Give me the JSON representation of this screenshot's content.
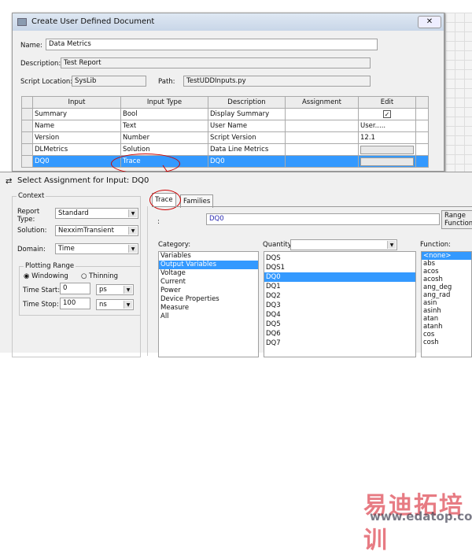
{
  "top_dialog": {
    "title": "Create User Defined Document",
    "name_label": "Name:",
    "name_value": "Data Metrics",
    "description_label": "Description:",
    "description_value": "Test Report",
    "script_location_label": "Script Location:",
    "script_location_value": "SysLib",
    "path_label": "Path:",
    "path_value": "TestUDDInputs.py",
    "columns": [
      "Input",
      "Input Type",
      "Description",
      "Assignment",
      "Edit"
    ],
    "rows": [
      {
        "input": "Summary",
        "type": "Bool",
        "description": "Display Summary",
        "assignment": "",
        "edit": "checkbox-checked"
      },
      {
        "input": "Name",
        "type": "Text",
        "description": "User Name",
        "assignment": "",
        "edit": "User....."
      },
      {
        "input": "Version",
        "type": "Number",
        "description": "Script Version",
        "assignment": "",
        "edit": "12.1"
      },
      {
        "input": "DLMetrics",
        "type": "Solution",
        "description": "Data Line Metrics",
        "assignment": "",
        "edit": "button"
      },
      {
        "input": "DQ0",
        "type": "Trace",
        "description": "DQ0",
        "assignment": "",
        "edit": "button"
      }
    ]
  },
  "bottom_dialog": {
    "title": "Select Assignment for Input: DQ0",
    "context": {
      "label": "Context",
      "report_type_label": "Report Type:",
      "report_type_value": "Standard",
      "solution_label": "Solution:",
      "solution_value": "NexximTransient",
      "domain_label": "Domain:",
      "domain_value": "Time",
      "plotting_range_label": "Plotting Range",
      "windowing_label": "Windowing",
      "thinning_label": "Thinning",
      "time_start_label": "Time Start:",
      "time_start_value": "0",
      "time_start_unit": "ps",
      "time_stop_label": "Time Stop:",
      "time_stop_value": "100",
      "time_stop_unit": "ns"
    },
    "tabs": [
      "Trace",
      "Families"
    ],
    "expr_label": ":",
    "expr_value": "DQ0",
    "range_function_label": "Range Function...",
    "category_label": "Category:",
    "categories": [
      "Variables",
      "Output Variables",
      "Voltage",
      "Current",
      "Power",
      "Device Properties",
      "Measure",
      "All"
    ],
    "quantity_label": "Quantity:",
    "quantity_value": "",
    "quantities": [
      "DQS",
      "DQS1",
      "DQ0",
      "DQ1",
      "DQ2",
      "DQ3",
      "DQ4",
      "DQ5",
      "DQ6",
      "DQ7"
    ],
    "function_label": "Function:",
    "functions": [
      "<none>",
      "abs",
      "acos",
      "acosh",
      "ang_deg",
      "ang_rad",
      "asin",
      "asinh",
      "atan",
      "atanh",
      "cos",
      "cosh"
    ]
  },
  "watermark": {
    "text": "易迪拓培训",
    "url": "www.edatop.com"
  },
  "colors": {
    "selection": "#3399ff",
    "annotation": "#cc0000"
  }
}
